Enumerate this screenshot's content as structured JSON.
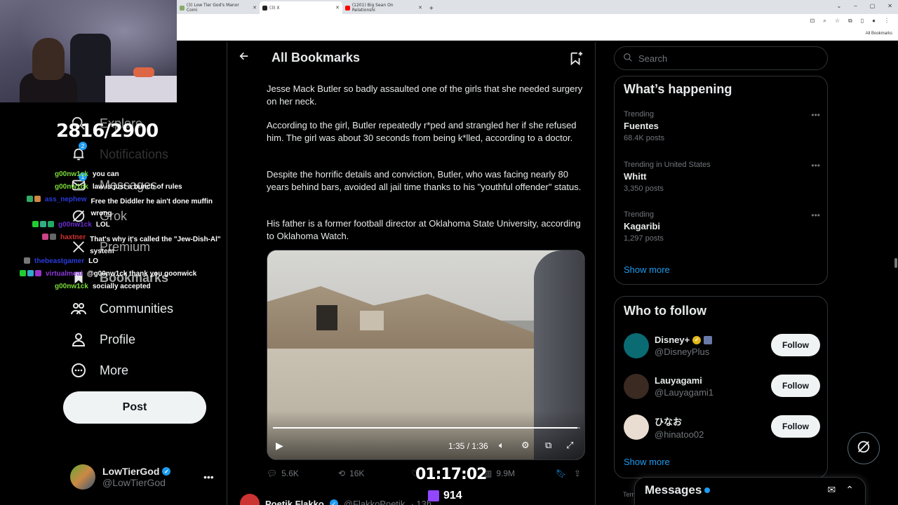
{
  "browser": {
    "tabs": [
      {
        "label": "(3) Low Tier God's Manor Comi",
        "favicon": "tab-lowtier"
      },
      {
        "label": "(3) X",
        "favicon": "tab-x"
      },
      {
        "label": "(1201) Big Sean On Relationshi",
        "favicon": "tab-youtube"
      }
    ],
    "all_bookmarks": "All Bookmarks"
  },
  "stream": {
    "counter": "2816/2900",
    "timer": "01:17:02",
    "viewers": "914",
    "chat": [
      {
        "user": "g00nw1ck",
        "msg": "you can",
        "color": "#7bdc3a"
      },
      {
        "user": "g00nw1ck",
        "msg": "law is just a bunch of rules",
        "color": "#7bdc3a"
      },
      {
        "user": "ass_nephew",
        "msg": "Free the Diddler he ain't done muffin wrong",
        "color": "#2a3bdc"
      },
      {
        "user": "g00nw1ck",
        "msg": "LOL",
        "color": "#6a2ad0"
      },
      {
        "user": "haxtner",
        "msg": "That's why it's called the \"Jew-Dish-Al\" system",
        "color": "#d03030"
      },
      {
        "user": "thebeastgamer",
        "msg": "LO",
        "color": "#2a3bdc"
      },
      {
        "user": "virtualmeal",
        "msg": "@g00nw1ck thank you goonwick",
        "color": "#8a3ad6"
      },
      {
        "user": "g00nw1ck",
        "msg": "socially accepted",
        "color": "#7bdc3a"
      }
    ]
  },
  "nav": {
    "items": [
      {
        "label": "Explore",
        "icon": "search-icon"
      },
      {
        "label": "Notifications",
        "icon": "bell-icon",
        "badge": "2"
      },
      {
        "label": "Messages",
        "icon": "mail-icon",
        "badge": "1"
      },
      {
        "label": "Grok",
        "icon": "grok-icon"
      },
      {
        "label": "Premium",
        "icon": "x-icon"
      },
      {
        "label": "Bookmarks",
        "icon": "bookmark-icon"
      },
      {
        "label": "Communities",
        "icon": "communities-icon"
      },
      {
        "label": "Profile",
        "icon": "profile-icon"
      },
      {
        "label": "More",
        "icon": "more-icon"
      }
    ],
    "post_label": "Post",
    "account": {
      "name": "LowTierGod",
      "handle": "@LowTierGod"
    }
  },
  "main": {
    "title": "All Bookmarks",
    "paragraphs": [
      "Jesse Mack Butler so badly assaulted one of the girls that she needed surgery on her neck.",
      "According to the girl, Butler repeatedly r*ped and strangled her if she refused him. The girl was about 30 seconds from being k*lled, according to a doctor.",
      "Despite the horrific details and conviction, Butler, who was facing nearly 80 years behind bars, avoided all jail time thanks to his \"youthful offender\" status.",
      "His father is a former football director at Oklahoma State University, according to Oklahoma Watch."
    ],
    "video": {
      "time": "1:35 / 1:36",
      "progress": 0.99
    },
    "actions": {
      "replies": "5.6K",
      "reposts": "16K",
      "likes": "",
      "views": "9.9M"
    },
    "next_tweet": {
      "name": "Poetik Flakko",
      "handle": "@FlakkoPoetik",
      "time": "· 13h"
    }
  },
  "right": {
    "search_placeholder": "Search",
    "happening_title": "What’s happening",
    "trends": [
      {
        "context": "Trending",
        "name": "Fuentes",
        "count": "68.4K posts"
      },
      {
        "context": "Trending in United States",
        "name": "Whitt",
        "count": "3,350 posts"
      },
      {
        "context": "Trending",
        "name": "Kagaribi",
        "count": "1,297 posts"
      }
    ],
    "show_more": "Show more",
    "wtf_title": "Who to follow",
    "follow": [
      {
        "name": "Disney+",
        "handle": "@DisneyPlus",
        "avatar_color": "#0a6b73"
      },
      {
        "name": "Lauyagami",
        "handle": "@Lauyagami1",
        "avatar_color": "#3a2a22"
      },
      {
        "name": "ひなお",
        "handle": "@hinatoo02",
        "avatar_color": "#e8ddd0"
      }
    ],
    "follow_label": "Follow",
    "show_more_2": "Show more",
    "messages_label": "Messages",
    "terms": "Terr"
  }
}
